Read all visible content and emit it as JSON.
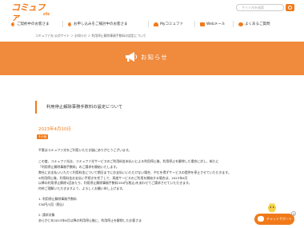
{
  "brand": {
    "logo_text": "コミュファ",
    "logo_sub": "Powered by ctc"
  },
  "search": {
    "placeholder": "サイト内を検索"
  },
  "nav": {
    "items": [
      {
        "label": "ご契約中のお客さま"
      },
      {
        "label": "お申し込みをご検討中のお客さま"
      },
      {
        "label": "Myコミュファ"
      },
      {
        "label": "Webメール"
      },
      {
        "label": "よくあるご質問"
      }
    ]
  },
  "breadcrumb": "コミュファ光 公式サイト ＞ お知らせ ＞ 利用停止解除事務手数料の設定について",
  "banner": {
    "title": "お知らせ"
  },
  "article": {
    "title": "利用停止解除事務手数料の設定について",
    "date": "2023年4月10日",
    "badge": "その他",
    "lines": [
      "平素はコミュファ光をご利用いただき誠にありがとうございます。",
      "この度、コミュファ光は、コミュファ光サービスのご利用料金未払いによる利用停止後、利用停止を解除した場合に対し、新たに",
      "「利用停止解除事務手数料」のご請求を開始いたします。",
      "弊社にお支払いいただく利用料金について期日までにお支払いいただけない場合、やむを得ずサービスの提供を停止させていただきます。",
      "※利用停止後、利用料金お支払い手続きを完了して、再度サービスのご利用を開始する場合は、2023年6月",
      "以降の利用停止解除1回あたり、利用停止解除事務手数料330円(税込)をあわせてご請求させていただきます。",
      "何卒ご理解いただきますよう、よろしくお願い申し上げます。",
      "",
      "1. 利用停止解除事務手数料",
      "330円/1回（税込）",
      "",
      "2. 請求対象",
      "あらかじめ2023年6月以降の利用停止後に、利用停止を解除したお客さま"
    ]
  },
  "chat": {
    "label": "チャットサポート"
  },
  "colors": {
    "accent": "#f07a1a",
    "banner": "#f08a3c"
  }
}
